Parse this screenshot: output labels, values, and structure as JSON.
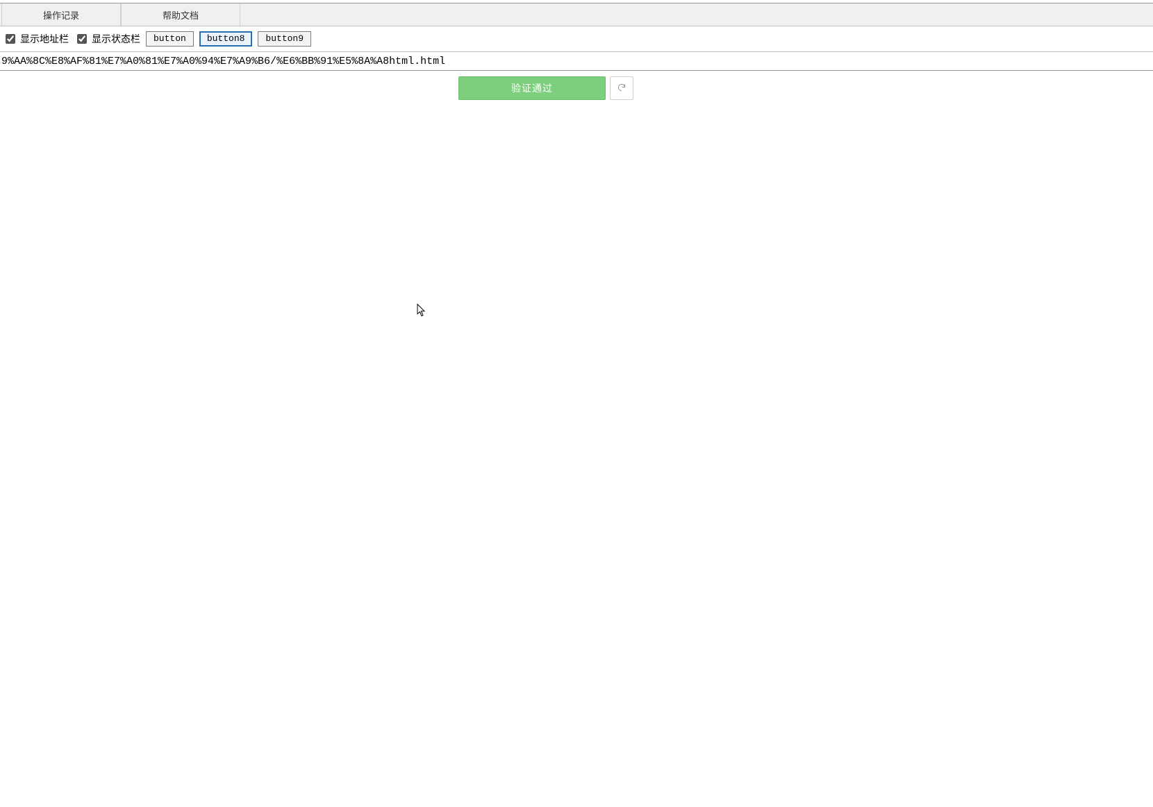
{
  "tabs": [
    {
      "label": "操作记录"
    },
    {
      "label": "帮助文档"
    }
  ],
  "toolbar": {
    "show_address_label": "显示地址栏",
    "show_address_checked": true,
    "show_status_label": "显示状态栏",
    "show_status_checked": true,
    "button_label": "button",
    "button8_label": "button8",
    "button9_label": "button9"
  },
  "address": {
    "value": "9%AA%8C%E8%AF%81%E7%A0%81%E7%A0%94%E7%A9%B6/%E6%BB%91%E5%8A%A8html.html"
  },
  "content": {
    "verify_label": "验证通过",
    "refresh_icon": "refresh-icon"
  }
}
